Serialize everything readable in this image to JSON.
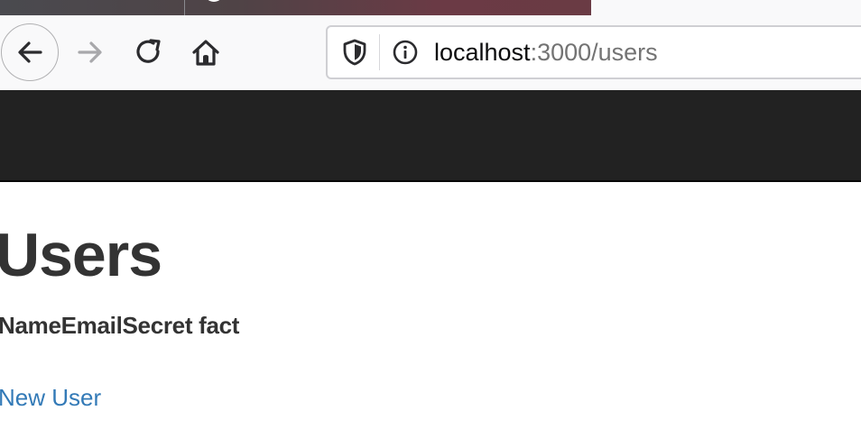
{
  "browser": {
    "icons": {
      "back": "arrow-left-icon",
      "forward": "arrow-right-icon",
      "reload": "reload-icon",
      "home": "home-icon",
      "tracking_protection": "shield-icon",
      "site_info": "info-icon"
    },
    "url": {
      "host": "localhost",
      "rest": ":3000/users"
    }
  },
  "page": {
    "title": "Users",
    "table": {
      "headers": [
        "Name",
        "Email",
        "Secret fact"
      ]
    },
    "new_user_link": "New User"
  },
  "colors": {
    "navbar": "#222222",
    "heading": "#333333",
    "link": "#337ab7",
    "toolbar": "#f9f9fa"
  }
}
